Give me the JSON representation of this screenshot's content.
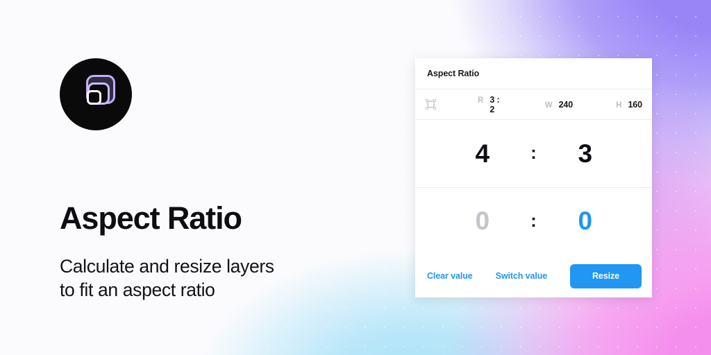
{
  "background": {
    "base_color": "#fbfbfd",
    "accent_purple": "#9a85f7",
    "accent_pink": "#f58fee",
    "accent_cyan": "#a9e2f8"
  },
  "branding": {
    "logo_icon": "nested-rounded-squares-logo",
    "logo_background": "#0a0a0a",
    "logo_stroke_purple": "#c4aefb",
    "logo_stroke_white": "#ffffff",
    "title": "Aspect Ratio",
    "subtitle_line_1": "Calculate and resize layers",
    "subtitle_line_2": "to fit an aspect ratio"
  },
  "plugin": {
    "header": {
      "title": "Aspect Ratio"
    },
    "toolbar": {
      "frame_icon": "selection-frame-icon",
      "fields": [
        {
          "label": "R",
          "value": "3 : 2"
        },
        {
          "label": "W",
          "value": "240"
        },
        {
          "label": "H",
          "value": "160"
        }
      ]
    },
    "ratio_primary": {
      "width": "4",
      "separator": ":",
      "height": "3"
    },
    "ratio_secondary": {
      "width": "0",
      "separator": ":",
      "height": "0",
      "width_state": "placeholder",
      "height_state": "focused",
      "focus_color": "#1f96f2"
    },
    "footer": {
      "clear_label": "Clear value",
      "switch_label": "Switch value",
      "resize_label": "Resize",
      "link_color": "#2196f3",
      "button_color": "#2196f3"
    }
  }
}
